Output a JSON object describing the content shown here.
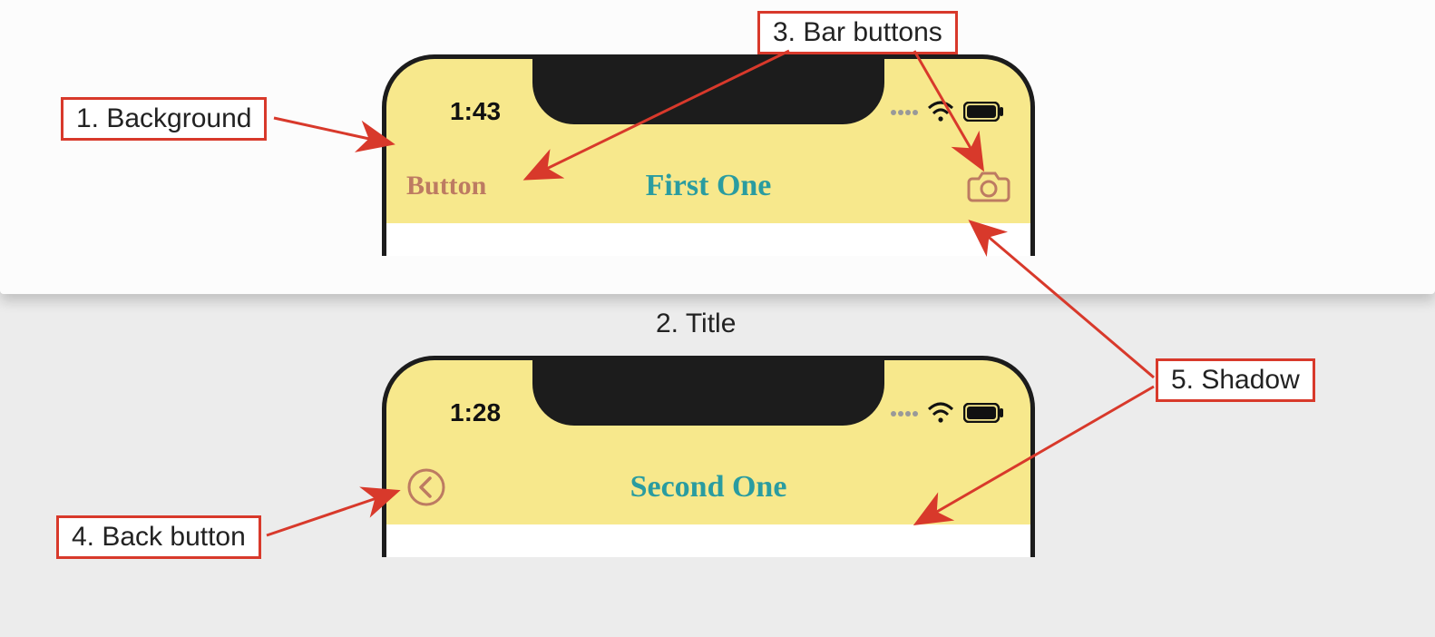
{
  "callouts": {
    "background": "1. Background",
    "title": "2. Title",
    "bar_buttons": "3. Bar buttons",
    "back_button": "4. Back button",
    "shadow": "5. Shadow"
  },
  "phone_a": {
    "time": "1:43",
    "left_button_label": "Button",
    "title": "First One"
  },
  "phone_b": {
    "time": "1:28",
    "title": "Second One"
  },
  "colors": {
    "nav_bg": "#f7e88c",
    "title_color": "#2a9ca0",
    "button_color": "#bd7b62",
    "callout_border": "#d8392b"
  }
}
